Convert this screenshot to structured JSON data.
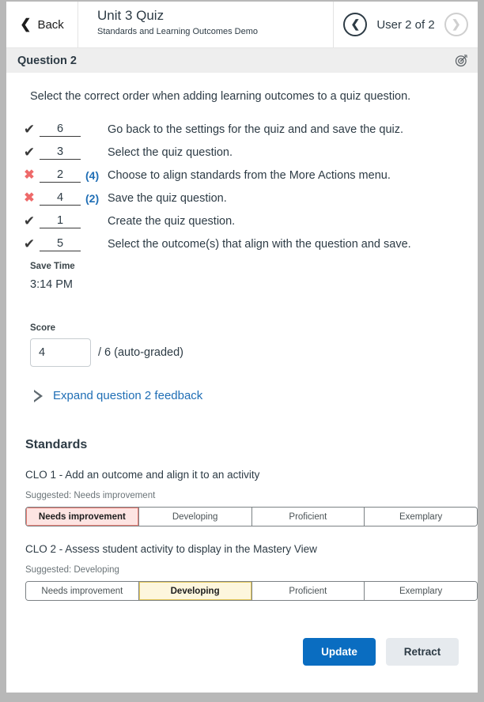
{
  "header": {
    "back_label": "Back",
    "back_icon": "chevron-left-icon",
    "quiz_title": "Unit 3 Quiz",
    "course_subtitle": "Standards and Learning Outcomes Demo",
    "prev_icon": "chevron-left-circle-icon",
    "next_icon": "chevron-right-circle-icon",
    "user_nav_label": "User 2 of 2"
  },
  "question_bar": {
    "title": "Question 2",
    "outcome_icon": "target-bullseye-icon"
  },
  "question": {
    "prompt": "Select the correct order when adding learning outcomes to a quiz question.",
    "items": [
      {
        "status": "correct",
        "mark": "✔",
        "answer": "6",
        "correction": "",
        "text": "Go back to the settings for the quiz and and save the quiz."
      },
      {
        "status": "correct",
        "mark": "✔",
        "answer": "3",
        "correction": "",
        "text": "Select the quiz question."
      },
      {
        "status": "incorrect",
        "mark": "✖",
        "answer": "2",
        "correction": "(4)",
        "text": "Choose to align standards from the More Actions menu."
      },
      {
        "status": "incorrect",
        "mark": "✖",
        "answer": "4",
        "correction": "(2)",
        "text": "Save the quiz question."
      },
      {
        "status": "correct",
        "mark": "✔",
        "answer": "1",
        "correction": "",
        "text": "Create the quiz question."
      },
      {
        "status": "correct",
        "mark": "✔",
        "answer": "5",
        "correction": "",
        "text": "Select the outcome(s) that align with the question and save."
      }
    ]
  },
  "save_time": {
    "label": "Save Time",
    "value": "3:14 PM"
  },
  "score": {
    "label": "Score",
    "value": "4",
    "placeholder": "",
    "out_of": "/ 6  (auto-graded)"
  },
  "feedback": {
    "toggle_icon": "triangle-right-icon",
    "toggle_label": "Expand question 2 feedback"
  },
  "standards": {
    "heading": "Standards",
    "outcomes": [
      {
        "name": "CLO 1 - Add an outcome and align it to an activity",
        "suggested": "Suggested: Needs improvement",
        "selected": "Needs improvement",
        "highlight": "red",
        "levels": [
          "Needs improvement",
          "Developing",
          "Proficient",
          "Exemplary"
        ]
      },
      {
        "name": "CLO 2 - Assess student activity to display in the Mastery View",
        "suggested": "Suggested: Developing",
        "selected": "Developing",
        "highlight": "yellow",
        "levels": [
          "Needs improvement",
          "Developing",
          "Proficient",
          "Exemplary"
        ]
      }
    ]
  },
  "footer": {
    "update_label": "Update",
    "retract_label": "Retract"
  },
  "colors": {
    "primary": "#0a6dc1",
    "link": "#1f6eb5",
    "incorrect": "#ee6a6a",
    "red_highlight": "#fde4e2",
    "yellow_highlight": "#fdf6dd"
  }
}
